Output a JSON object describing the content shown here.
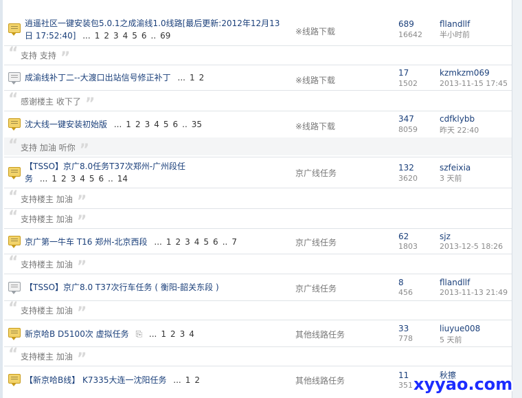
{
  "threads": [
    {
      "icon": "new",
      "title_line1": "逍遥社区一键安装包5.0.1之成渝线1.0线路[最后更新:2012年12月13",
      "title_line2": "日 17:52:40]",
      "pages": [
        "...",
        "1",
        "2",
        "3",
        "4",
        "5",
        "6",
        "..",
        "69"
      ],
      "forum": "※线路下载",
      "replies": "689",
      "views": "16642",
      "last_user": "fllandllf",
      "last_time": "半小时前",
      "quote": "支持  支持"
    },
    {
      "icon": "old",
      "title_line1": "成渝线补丁二--大渡口出站信号修正补丁",
      "title_line2": "",
      "pages": [
        "...",
        "1",
        "2"
      ],
      "forum": "※线路下载",
      "replies": "17",
      "views": "1502",
      "last_user": "kzmkzm069",
      "last_time": "2013-11-15 17:45",
      "quote": "感谢楼主  收下了"
    },
    {
      "icon": "new",
      "title_line1": "沈大线一键安装初始版",
      "title_line2": "",
      "pages": [
        "...",
        "1",
        "2",
        "3",
        "4",
        "5",
        "6",
        "..",
        "35"
      ],
      "forum": "※线路下载",
      "replies": "347",
      "views": "8059",
      "last_user": "cdfklybb",
      "last_time": "昨天 22:40",
      "quote": "支持  加油  听你"
    },
    {
      "icon": "new",
      "title_line1": "【TSSO】京广8.0任务T37次郑州-广州段任",
      "title_line2": "务",
      "pages": [
        "...",
        "1",
        "2",
        "3",
        "4",
        "5",
        "6",
        "..",
        "14"
      ],
      "forum": "京广线任务",
      "replies": "132",
      "views": "3620",
      "last_user": "szfeixia",
      "last_time": "3 天前",
      "quote": "支持楼主  加油",
      "quote2": "支持楼主  加油"
    },
    {
      "icon": "new",
      "title_line1": "京广第一牛车  T16 郑州-北京西段",
      "title_line2": "",
      "pages": [
        "...",
        "1",
        "2",
        "3",
        "4",
        "5",
        "6",
        "..",
        "7"
      ],
      "forum": "京广线任务",
      "replies": "62",
      "views": "1803",
      "last_user": "sjz",
      "last_time": "2013-12-5 18:26",
      "quote": "支持楼主  加油"
    },
    {
      "icon": "old",
      "title_line1": "【TSSO】京广8.0 T37次行车任务 ( 衡阳-韶关东段 )",
      "title_line2": "",
      "pages": [],
      "forum": "京广线任务",
      "replies": "8",
      "views": "456",
      "last_user": "fllandllf",
      "last_time": "2013-11-13 21:49",
      "quote": "支持楼主  加油"
    },
    {
      "icon": "new",
      "title_line1": "新京哈B D5100次  虚拟任务",
      "title_line2": "",
      "attachment": "⎘",
      "pages": [
        "...",
        "1",
        "2",
        "3",
        "4"
      ],
      "forum": "其他线路任务",
      "replies": "33",
      "views": "778",
      "last_user": "liuyue008",
      "last_time": "5 天前",
      "quote": "支持楼主  加油"
    },
    {
      "icon": "new",
      "title_line1": "【新京哈B线】  K7335大连一沈阳任务",
      "title_line2": "",
      "pages": [
        "...",
        "1",
        "2"
      ],
      "forum": "其他线路任务",
      "replies": "11",
      "views": "351",
      "last_user": "秋擦",
      "last_time": "",
      "quote": ""
    }
  ],
  "watermark": "xyyao.com",
  "colors": {
    "link": "#1a3f7a",
    "icon_new": "#f2d36b",
    "icon_old": "#f1f1f1",
    "watermark": "#1c2cff"
  }
}
